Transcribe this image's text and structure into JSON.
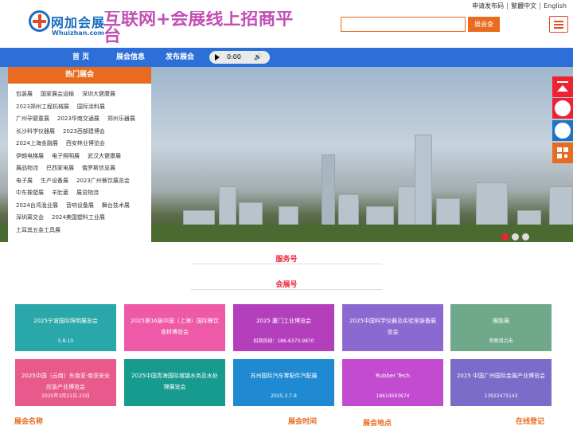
{
  "top_links": [
    "申请发布码",
    "繁體中文",
    "English"
  ],
  "logo": {
    "cn": "网加会展",
    "en": "Whuizhan.com"
  },
  "slogan": "互联网+会展线上招商平台",
  "search": {
    "value": "",
    "button": "展会查"
  },
  "nav": {
    "items": [
      "首 页",
      "展会信息",
      "发布展会"
    ]
  },
  "audio": {
    "time": "0:00"
  },
  "hot": {
    "title": "热门展会",
    "items": [
      "包装展",
      "国家展会运输",
      "深圳大健康展",
      "2023郑州工程机械展",
      "国际涂料展",
      "广州孕婴童展",
      "2023华南交通展",
      "郑州乐器展",
      "长沙科学仪器展",
      "2023西部建博会",
      "2024上海金融展",
      "西安林业博览会",
      "伊朗电梯展",
      "电子照明展",
      "武汉大健康展",
      "展品物流",
      "巴西家电展",
      "俄罗斯信息展",
      "电子展",
      "生产设备展",
      "2023广州餐饮展览会",
      "中东橡塑展",
      "羊肚菌",
      "展览物流",
      "2024台湾渔业展",
      "音响设备展",
      "舞台技术展",
      "深圳离交会",
      "2024美国塑料工业展",
      "土耳其五金工具展"
    ]
  },
  "sections": {
    "service": "服务号",
    "exhibition": "会展号"
  },
  "cards": [
    {
      "title": "2025宁波国际照明展览会",
      "sub": "5.8-10",
      "color": "#2aa7a9"
    },
    {
      "title": "2025第16届中国（上海）国际餐饮食材博览会",
      "sub": "",
      "color": "#ee5aa7"
    },
    {
      "title": "2025 厦门工业博览会",
      "sub": "招商热线：186-6370-9870",
      "color": "#b43fbd"
    },
    {
      "title": "2025中国科学仪器及实验室装备展览会",
      "sub": "",
      "color": "#8a6ad1"
    },
    {
      "title": "橡胶展",
      "sub": "参观请点击",
      "color": "#6fa88a"
    },
    {
      "title": "2025中国（云南）东南亚·南亚安全应急产业博览会",
      "sub": "2025年3月21日-23日",
      "color": "#e85a8b"
    },
    {
      "title": "2025中国青海国际城镇水务及水处理展览会",
      "sub": "",
      "color": "#169b8e"
    },
    {
      "title": "苏州国际汽车零配件汽配展",
      "sub": "2025.3.7-9",
      "color": "#1f8ad1"
    },
    {
      "title": "Rubber Tech",
      "sub": "18614593674",
      "color": "#c34bd0"
    },
    {
      "title": "2025 中国广州国际金属产业博览会",
      "sub": "13922475143",
      "color": "#7a6cc8"
    }
  ],
  "bottom_labels": [
    "展会名称",
    "展会时间",
    "展会地点",
    "在线登记"
  ],
  "colors": {
    "primary": "#2d6fd9",
    "accent": "#e86b1f",
    "red": "#e23"
  }
}
